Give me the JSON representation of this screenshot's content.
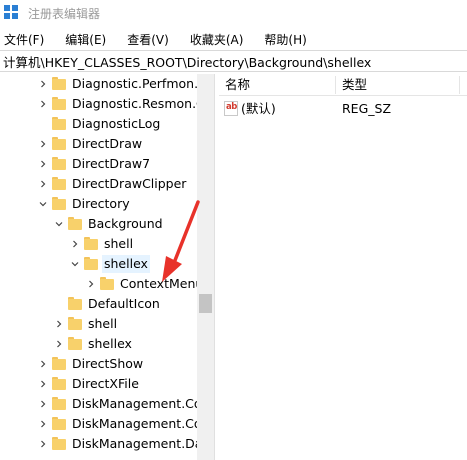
{
  "window": {
    "title": "注册表编辑器"
  },
  "menu": [
    "文件(F)",
    "编辑(E)",
    "查看(V)",
    "收藏夹(A)",
    "帮助(H)"
  ],
  "address": "计算机\\HKEY_CLASSES_ROOT\\Directory\\Background\\shellex",
  "tree": [
    {
      "label": "Diagnostic.Perfmon.D",
      "level": 1,
      "chevron": "right"
    },
    {
      "label": "Diagnostic.Resmon.C",
      "level": 1,
      "chevron": "right"
    },
    {
      "label": "DiagnosticLog",
      "level": 1,
      "chevron": "none"
    },
    {
      "label": "DirectDraw",
      "level": 1,
      "chevron": "right"
    },
    {
      "label": "DirectDraw7",
      "level": 1,
      "chevron": "right"
    },
    {
      "label": "DirectDrawClipper",
      "level": 1,
      "chevron": "right"
    },
    {
      "label": "Directory",
      "level": 1,
      "chevron": "down"
    },
    {
      "label": "Background",
      "level": 2,
      "chevron": "down"
    },
    {
      "label": "shell",
      "level": 3,
      "chevron": "right"
    },
    {
      "label": "shellex",
      "level": 3,
      "chevron": "down",
      "selected": true
    },
    {
      "label": "ContextMenu",
      "level": 4,
      "chevron": "right"
    },
    {
      "label": "DefaultIcon",
      "level": 2,
      "chevron": "none"
    },
    {
      "label": "shell",
      "level": 2,
      "chevron": "right"
    },
    {
      "label": "shellex",
      "level": 2,
      "chevron": "right"
    },
    {
      "label": "DirectShow",
      "level": 1,
      "chevron": "right"
    },
    {
      "label": "DirectXFile",
      "level": 1,
      "chevron": "right"
    },
    {
      "label": "DiskManagement.Cor",
      "level": 1,
      "chevron": "right"
    },
    {
      "label": "DiskManagement.Cor",
      "level": 1,
      "chevron": "right"
    },
    {
      "label": "DiskManagement.Dat",
      "level": 1,
      "chevron": "right"
    }
  ],
  "list": {
    "columns": [
      "名称",
      "类型",
      ""
    ],
    "rows": [
      {
        "name": "(默认)",
        "type": "REG_SZ",
        "icon": "ab"
      }
    ]
  },
  "annotation": {
    "color": "#e8322a"
  },
  "colors": {
    "selection": "#e5f3ff",
    "folder": "#f8d16b",
    "app_icon": "#2a7fd4"
  }
}
